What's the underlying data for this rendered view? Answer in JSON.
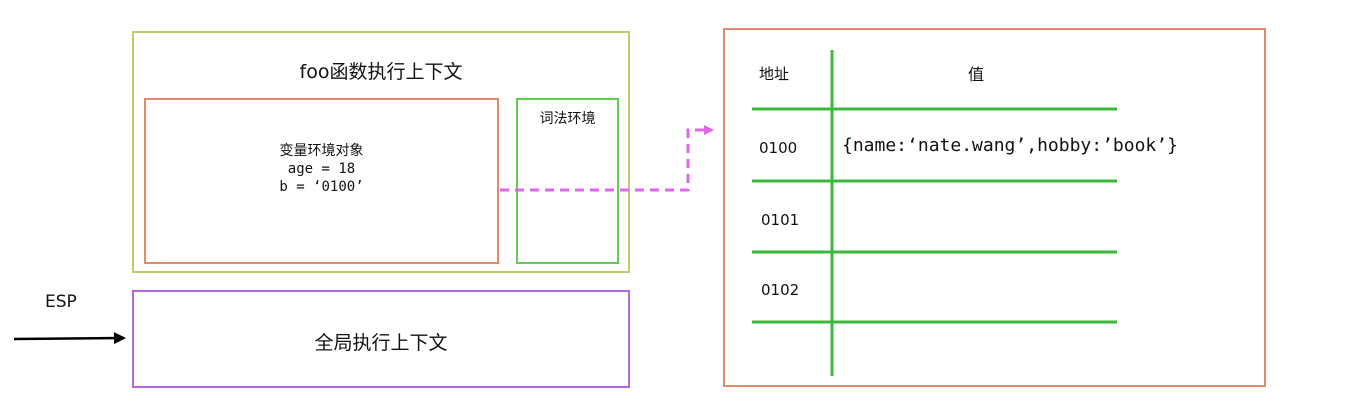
{
  "foo_context": {
    "title": "foo函数执行上下文",
    "variable_env": {
      "title": "变量环境对象",
      "line1": "age = 18",
      "line2": "b = ‘0100’"
    },
    "lexical_env": {
      "title": "词法环境"
    }
  },
  "global_context": {
    "title": "全局执行上下文"
  },
  "stack_pointer": {
    "label": "ESP"
  },
  "memory_table": {
    "header_address": "地址",
    "header_value": "值",
    "rows": [
      {
        "address": "0100",
        "value": "{name:‘nate.wang’,hobby:’book’}"
      },
      {
        "address": "0101",
        "value": ""
      },
      {
        "address": "0102",
        "value": ""
      }
    ]
  },
  "colors": {
    "foo_border": "#b9cf6a",
    "var_env_border": "#e08a70",
    "lex_env_border": "#5fcf4f",
    "global_border": "#b865e0",
    "memory_border": "#e08a70",
    "grid_lines": "#3cb83c",
    "pointer_arrow": "#e066f0"
  }
}
